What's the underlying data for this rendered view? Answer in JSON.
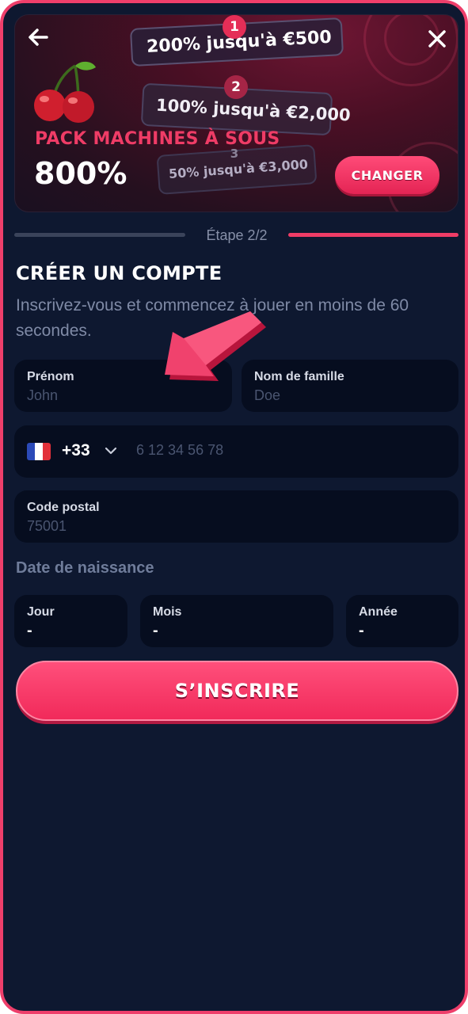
{
  "banner": {
    "tiers": [
      {
        "badge": "1",
        "text": "200% jusqu'à €500"
      },
      {
        "badge": "2",
        "text": "100% jusqu'à €2,000"
      },
      {
        "badge": "3",
        "text": "50% jusqu'à €3,000"
      }
    ],
    "pack_title": "PACK MACHINES À SOUS",
    "pack_percent": "800%",
    "change_label": "CHANGER"
  },
  "progress": {
    "step_label": "Étape 2/2"
  },
  "form": {
    "title": "CRÉER UN COMPTE",
    "subtitle": "Inscrivez-vous et commencez à jouer en moins de 60 secondes.",
    "first_name": {
      "label": "Prénom",
      "placeholder": "John"
    },
    "last_name": {
      "label": "Nom de famille",
      "placeholder": "Doe"
    },
    "phone": {
      "country_code": "+33",
      "placeholder": "6 12 34 56 78"
    },
    "postal_code": {
      "label": "Code postal",
      "placeholder": "75001"
    },
    "dob": {
      "label": "Date de naissance",
      "day": {
        "label": "Jour",
        "value": "-"
      },
      "month": {
        "label": "Mois",
        "value": "-"
      },
      "year": {
        "label": "Année",
        "value": "-"
      }
    },
    "submit_label": "S’INSCRIRE"
  },
  "colors": {
    "accent": "#ef3c66",
    "background": "#0e1830",
    "field_bg": "#060d1f"
  },
  "icons": [
    "back-arrow-icon",
    "close-icon",
    "cherry-icon",
    "france-flag-icon",
    "chevron-down-icon",
    "pointer-arrow-icon"
  ]
}
